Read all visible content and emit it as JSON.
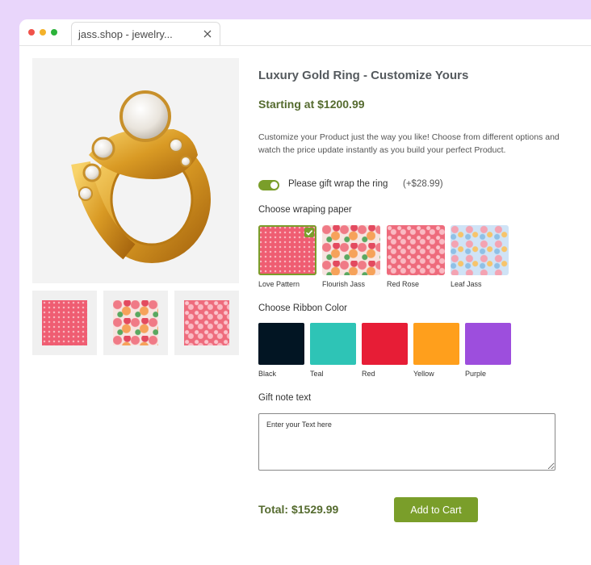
{
  "browser": {
    "tab_title": "jass.shop - jewelry...",
    "close_icon": "close-icon"
  },
  "product": {
    "title": "Luxury Gold Ring - Customize Yours",
    "price": "Starting at $1200.99",
    "description": "Customize your Product just the way you like! Choose from different options and watch the price update instantly as you build your perfect Product."
  },
  "gift_wrap": {
    "label": "Please gift wrap the ring",
    "extra_cost": "(+$28.99)",
    "enabled": true,
    "accent_color": "#7a9e2a"
  },
  "wrapping": {
    "heading": "Choose wraping paper",
    "options": [
      {
        "name": "Love Pattern",
        "selected": true
      },
      {
        "name": "Flourish Jass",
        "selected": false
      },
      {
        "name": "Red Rose",
        "selected": false
      },
      {
        "name": "Leaf Jass",
        "selected": false
      }
    ]
  },
  "ribbon": {
    "heading": "Choose Ribbon Color",
    "colors": [
      {
        "name": "Black",
        "hex": "#021523"
      },
      {
        "name": "Teal",
        "hex": "#2ec4b6"
      },
      {
        "name": "Red",
        "hex": "#e71d36"
      },
      {
        "name": "Yellow",
        "hex": "#ff9f1c"
      },
      {
        "name": "Purple",
        "hex": "#9d4edd"
      }
    ]
  },
  "gift_note": {
    "heading": "Gift note text",
    "placeholder": "Enter your Text here"
  },
  "cart": {
    "total": "Total: $1529.99",
    "button_label": "Add to Cart"
  }
}
